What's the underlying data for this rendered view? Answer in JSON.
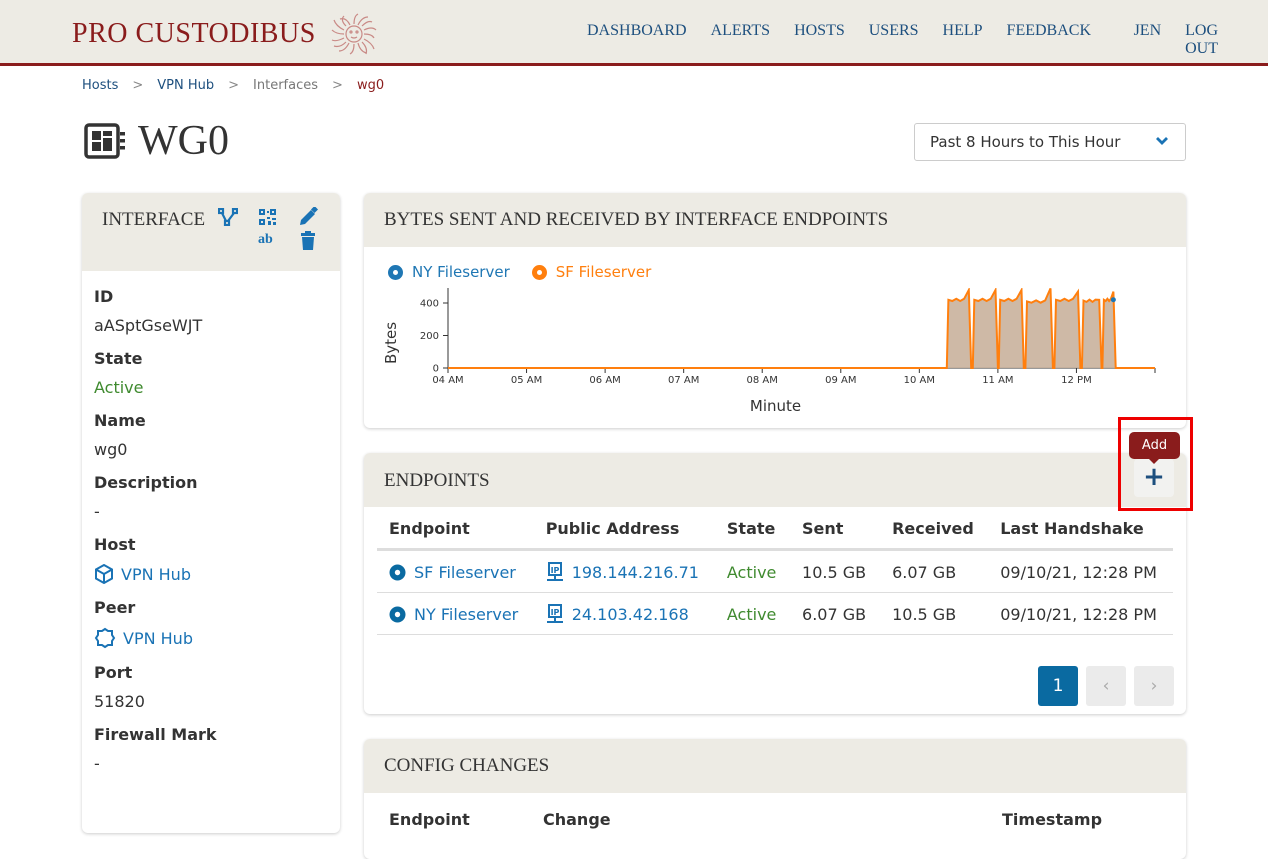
{
  "brand": {
    "name": "PRO CUSTODIBUS",
    "color": "#8a1c1c"
  },
  "nav": {
    "items": [
      "DASHBOARD",
      "ALERTS",
      "HOSTS",
      "USERS",
      "HELP",
      "FEEDBACK"
    ],
    "user": "JEN",
    "logout": "LOG OUT"
  },
  "breadcrumb": [
    "Hosts",
    "VPN Hub",
    "Interfaces",
    "wg0"
  ],
  "page": {
    "title": "WG0",
    "icon": "interface-card-icon"
  },
  "time_range": {
    "selected": "Past 8 Hours to This Hour"
  },
  "interface_panel": {
    "heading": "INTERFACE",
    "actions": [
      "topology-icon",
      "qr-code-icon",
      "text-ab-icon",
      "edit-pencil-icon",
      "delete-trash-icon"
    ],
    "fields": [
      {
        "label": "ID",
        "value": "aASptGseWJT"
      },
      {
        "label": "State",
        "value": "Active"
      },
      {
        "label": "Name",
        "value": "wg0"
      },
      {
        "label": "Description",
        "value": "-"
      },
      {
        "label": "Host",
        "value": "VPN Hub"
      },
      {
        "label": "Peer",
        "value": "VPN Hub"
      },
      {
        "label": "Port",
        "value": "51820"
      },
      {
        "label": "Firewall Mark",
        "value": "-"
      }
    ]
  },
  "chart_panel": {
    "heading": "BYTES SENT AND RECEIVED BY INTERFACE ENDPOINTS"
  },
  "chart_data": {
    "type": "area",
    "title": "BYTES SENT AND RECEIVED BY INTERFACE ENDPOINTS",
    "xlabel": "Minute",
    "ylabel": "Bytes",
    "x_ticks": [
      "04 AM",
      "05 AM",
      "06 AM",
      "07 AM",
      "08 AM",
      "09 AM",
      "10 AM",
      "11 AM",
      "12 PM"
    ],
    "y_ticks": [
      0,
      200,
      400
    ],
    "ylim": [
      0,
      480
    ],
    "xlim_hours": [
      4.0,
      13.0
    ],
    "legend": "top-left",
    "series": [
      {
        "name": "NY Fileserver",
        "color": "#1f77b4",
        "points": [
          [
            12.47,
            420
          ]
        ]
      },
      {
        "name": "SF Fileserver",
        "color": "#ff7f0e",
        "bursts": [
          {
            "start": 10.35,
            "end": 10.66,
            "level": 420,
            "peak": 480
          },
          {
            "start": 10.68,
            "end": 11.0,
            "level": 420,
            "peak": 480
          },
          {
            "start": 11.01,
            "end": 11.33,
            "level": 420,
            "peak": 480
          },
          {
            "start": 11.35,
            "end": 11.7,
            "level": 410,
            "peak": 490
          },
          {
            "start": 11.72,
            "end": 12.05,
            "level": 420,
            "peak": 470
          },
          {
            "start": 12.07,
            "end": 12.32,
            "level": 415,
            "peak": 420
          },
          {
            "start": 12.33,
            "end": 12.5,
            "level": 420,
            "peak": 470
          }
        ]
      }
    ]
  },
  "endpoints_panel": {
    "heading": "ENDPOINTS",
    "add_tooltip": "Add",
    "add_label": "+",
    "columns": [
      "Endpoint",
      "Public Address",
      "State",
      "Sent",
      "Received",
      "Last Handshake"
    ],
    "rows": [
      {
        "endpoint": "SF Fileserver",
        "address": "198.144.216.71",
        "state": "Active",
        "sent": "10.5 GB",
        "received": "6.07 GB",
        "handshake": "09/10/21, 12:28 PM"
      },
      {
        "endpoint": "NY Fileserver",
        "address": "24.103.42.168",
        "state": "Active",
        "sent": "6.07 GB",
        "received": "10.5 GB",
        "handshake": "09/10/21, 12:28 PM"
      }
    ],
    "pagination": {
      "current": "1",
      "prev": "‹",
      "next": "›"
    }
  },
  "config_panel": {
    "heading": "CONFIG CHANGES",
    "columns": [
      "Endpoint",
      "Change",
      "Timestamp"
    ]
  }
}
